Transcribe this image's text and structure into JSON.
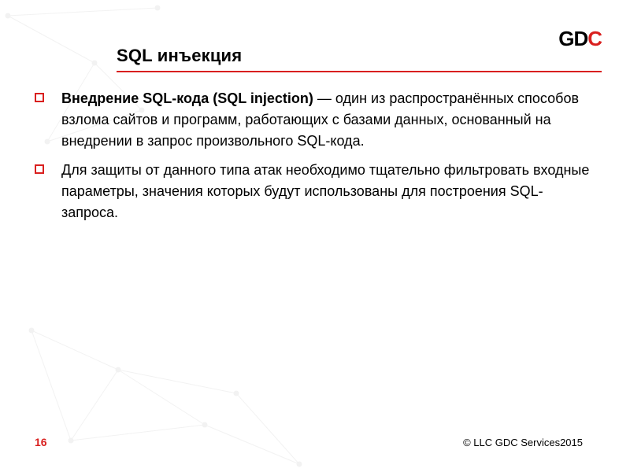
{
  "logo": {
    "text_black": "GD",
    "text_red": "C"
  },
  "title": "SQL инъекция",
  "bullets": [
    {
      "bold": "Внедрение SQL-кода (SQL injection)",
      "rest": " — один из распространённых способов взлома сайтов и программ, работающих с базами данных, основанный на внедрении в запрос произвольного SQL-кода."
    },
    {
      "bold": "",
      "rest": "Для защиты от данного типа атак необходимо тщательно фильтровать входные параметры, значения которых будут использованы для построения SQL-запроса."
    }
  ],
  "page_number": "16",
  "copyright": "© LLC GDC Services2015"
}
